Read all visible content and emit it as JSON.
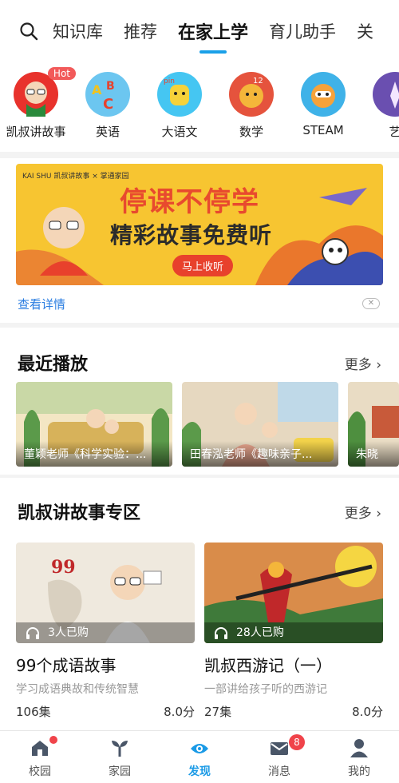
{
  "topnav": {
    "tabs": [
      {
        "label": "知识库",
        "active": false
      },
      {
        "label": "推荐",
        "active": false
      },
      {
        "label": "在家上学",
        "active": true
      },
      {
        "label": "育儿助手",
        "active": false
      },
      {
        "label": "关",
        "active": false
      }
    ]
  },
  "categories": [
    {
      "label": "凯叔讲故事",
      "badge": "Hot",
      "color": "#e8322c"
    },
    {
      "label": "英语",
      "color": "#6cc6f0"
    },
    {
      "label": "大语文",
      "color": "#45c6f2"
    },
    {
      "label": "数学",
      "color": "#e5533d"
    },
    {
      "label": "STEAM",
      "color": "#3fb2e8"
    },
    {
      "label": "艺",
      "color": "#6a4fb0"
    }
  ],
  "banner": {
    "brand_text": "KAI SHU 凯叔讲故事 × 掌通家园",
    "title_line1": "停课不停学",
    "title_line2": "精彩故事免费听",
    "cta": "马上收听",
    "detail_link": "查看详情"
  },
  "recent": {
    "title": "最近播放",
    "more": "更多",
    "items": [
      {
        "caption": "董颖老师《科学实验：..."
      },
      {
        "caption": "田春泓老师《趣味亲子..."
      },
      {
        "caption": "朱晓"
      }
    ]
  },
  "zone": {
    "title": "凯叔讲故事专区",
    "more": "更多",
    "items": [
      {
        "purchased": "3人已购",
        "name": "99个成语故事",
        "desc": "学习成语典故和传统智慧",
        "episodes": "106集",
        "score": "8.0分"
      },
      {
        "purchased": "28人已购",
        "name": "凯叔西游记（一）",
        "desc": "一部讲给孩子听的西游记",
        "episodes": "27集",
        "score": "8.0分"
      }
    ]
  },
  "tabbar": {
    "items": [
      {
        "label": "校园",
        "dot": true
      },
      {
        "label": "家园"
      },
      {
        "label": "发现",
        "active": true
      },
      {
        "label": "消息",
        "badge": "8"
      },
      {
        "label": "我的"
      }
    ]
  },
  "colors": {
    "accent": "#1a9ae6",
    "banner_bg": "#f7c531",
    "link": "#2a7de1",
    "badge_red": "#f0434a"
  }
}
